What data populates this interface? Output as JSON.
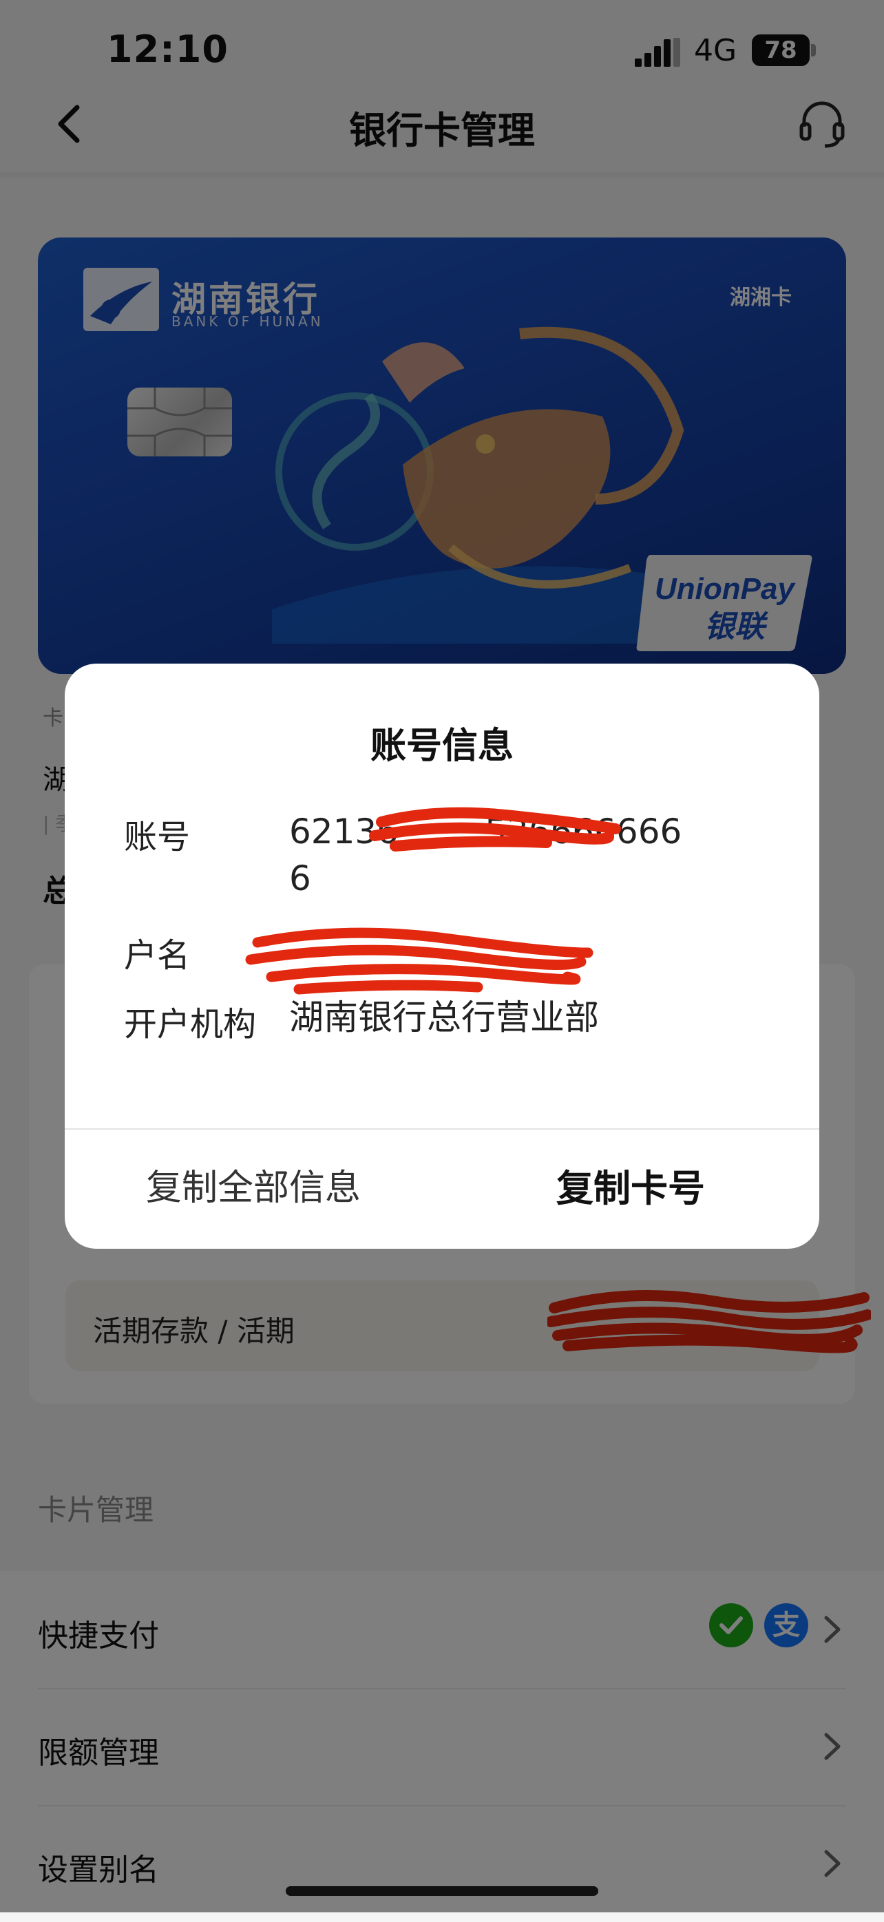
{
  "status_bar": {
    "time": "12:10",
    "network": "4G",
    "battery": "78"
  },
  "nav": {
    "title": "银行卡管理",
    "back_icon": "chevron-left-icon",
    "service_icon": "headset-icon"
  },
  "card": {
    "bank_name": "湖南银行",
    "bank_name_en": "BANK OF HUNAN",
    "card_type": "湖湘卡",
    "unionpay_en": "UnionPay",
    "unionpay_cn": "银联"
  },
  "card_info": {
    "label": "卡",
    "name": "湖",
    "sub": "| 季",
    "total": "总"
  },
  "account_row": {
    "label": "活期存款 / 活期"
  },
  "card_management": {
    "section_title": "卡片管理",
    "items": [
      {
        "label": "快捷支付"
      },
      {
        "label": "限额管理"
      },
      {
        "label": "设置别名"
      }
    ]
  },
  "dialog": {
    "title": "账号信息",
    "account_label": "账号",
    "account_value": "6213633666666",
    "account_value_visible_start": "62136",
    "account_value_visible_end": "536666666",
    "account_value_last": "6",
    "name_label": "户名",
    "institution_label": "开户机构",
    "institution_value": "湖南银行总行营业部",
    "copy_all": "复制全部信息",
    "copy_card": "复制卡号"
  },
  "colors": {
    "redaction": "#e2280e",
    "wechat": "#1aad19",
    "alipay": "#1677ff"
  }
}
